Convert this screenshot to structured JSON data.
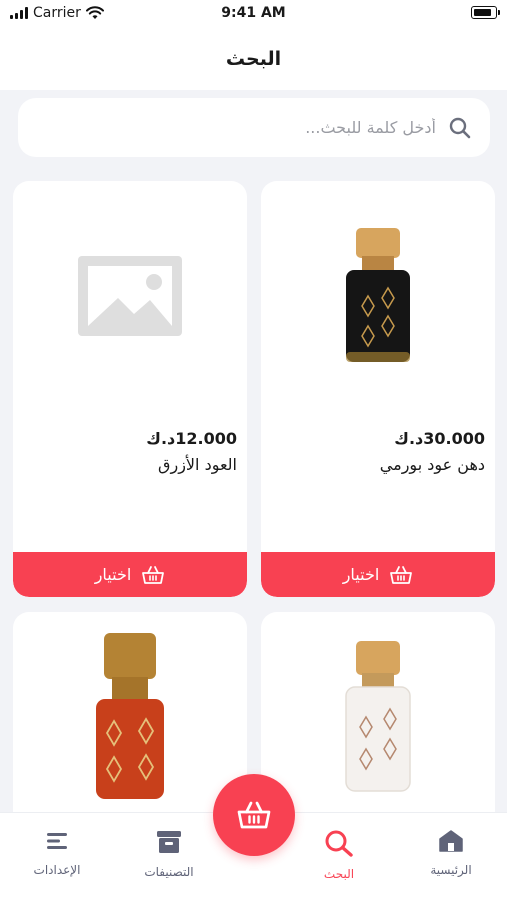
{
  "status_bar": {
    "carrier": "Carrier",
    "time": "9:41 AM"
  },
  "header": {
    "title": "البحث"
  },
  "search": {
    "placeholder": "أدخل كلمة للبحث..."
  },
  "products": [
    {
      "name": "دهن عود بورمي",
      "price": "30.000د.ك",
      "button_label": "اختيار",
      "image": "black-perfume-bottle"
    },
    {
      "name": "العود الأزرق",
      "price": "12.000د.ك",
      "button_label": "اختيار",
      "image": "placeholder-image"
    },
    {
      "name": "",
      "price": "",
      "button_label": "",
      "image": "clear-perfume-bottle"
    },
    {
      "name": "",
      "price": "",
      "button_label": "",
      "image": "red-perfume-bottle"
    }
  ],
  "bottom_nav": {
    "items": [
      {
        "label": "الرئيسية",
        "icon": "home-icon",
        "active": false
      },
      {
        "label": "البحث",
        "icon": "search-icon",
        "active": true
      },
      {
        "label": "التصنيفات",
        "icon": "categories-icon",
        "active": false
      },
      {
        "label": "الإعدادات",
        "icon": "settings-icon",
        "active": false
      }
    ]
  },
  "colors": {
    "accent": "#f84152",
    "background": "#f2f3f7",
    "nav_text": "#5f6378"
  }
}
